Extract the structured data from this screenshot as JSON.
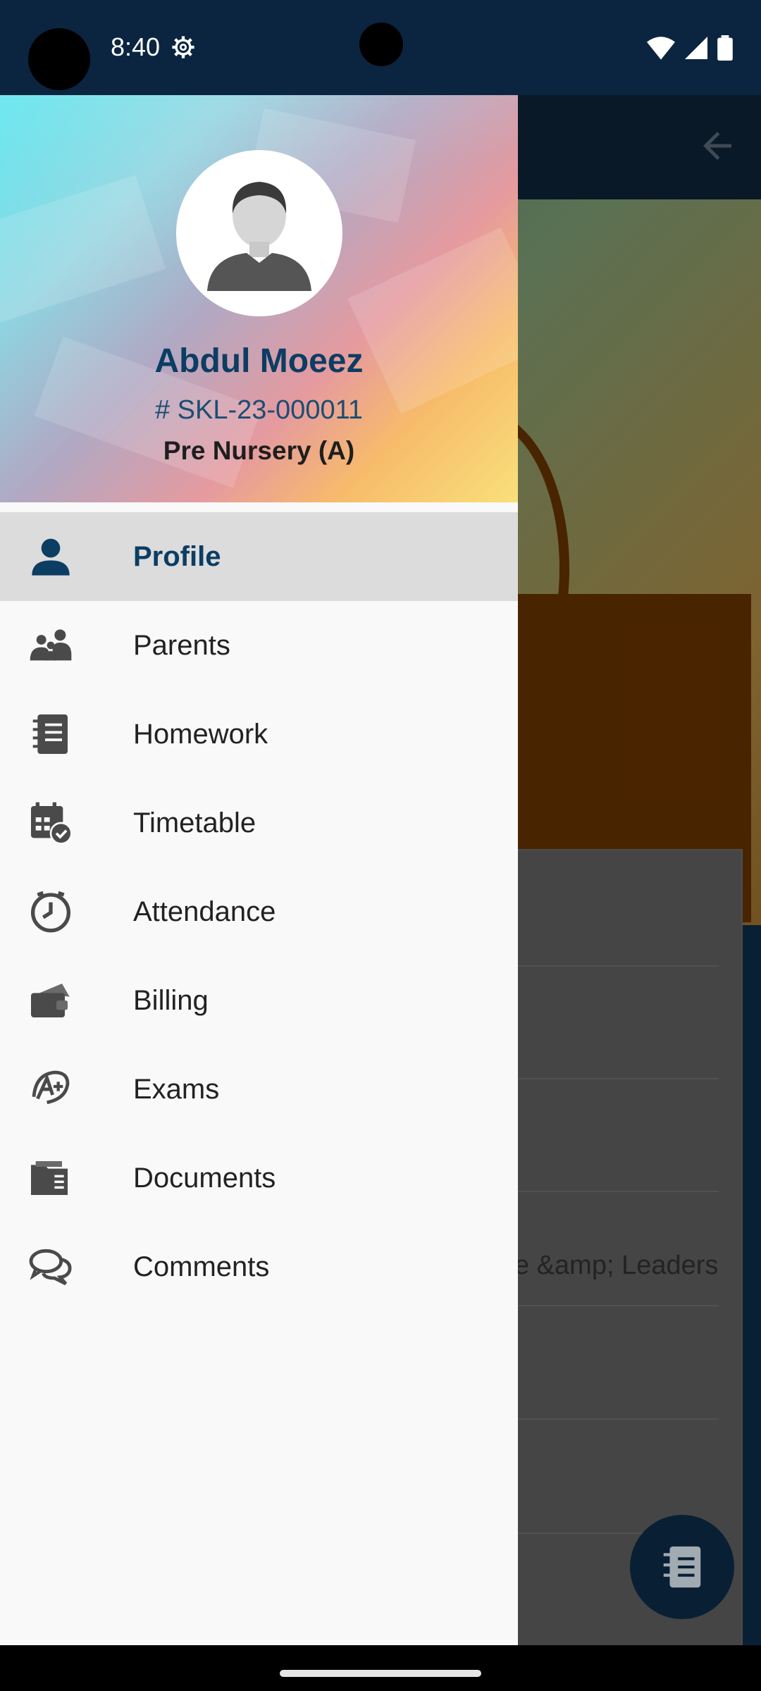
{
  "status_bar": {
    "time": "8:40"
  },
  "background_app": {
    "partial_text": "e &amp; Leaders"
  },
  "drawer": {
    "user": {
      "name": "Abdul Moeez",
      "id_code": "# SKL-23-000011",
      "class": "Pre Nursery (A)"
    },
    "items": [
      {
        "label": "Profile",
        "icon": "person-icon",
        "active": true
      },
      {
        "label": "Parents",
        "icon": "parents-icon"
      },
      {
        "label": "Homework",
        "icon": "notebook-icon"
      },
      {
        "label": "Timetable",
        "icon": "calendar-icon"
      },
      {
        "label": "Attendance",
        "icon": "clock-icon"
      },
      {
        "label": "Billing",
        "icon": "wallet-icon"
      },
      {
        "label": "Exams",
        "icon": "grade-icon"
      },
      {
        "label": "Documents",
        "icon": "folder-icon"
      },
      {
        "label": "Comments",
        "icon": "comments-icon"
      }
    ]
  },
  "colors": {
    "primary": "#0c3d63",
    "status_bar": "#0b2540",
    "active_item_bg": "#dcdcdc"
  }
}
